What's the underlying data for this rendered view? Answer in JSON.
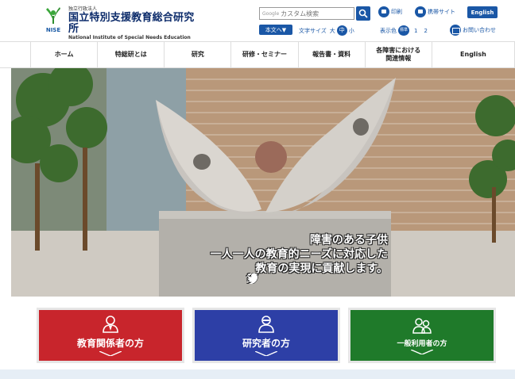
{
  "header": {
    "logo_small": "独立行政法人",
    "logo_jp": "国立特別支援教育総合研究所",
    "logo_en": "National Institute of Special Needs Education",
    "logo_mark": "NISE",
    "search_provider": "Google",
    "search_placeholder": "カスタム検索",
    "print_label": "印刷",
    "mobile_label": "携帯サイト",
    "english_label": "English",
    "skip_label": "本文へ▼",
    "font_size_label": "文字サイズ",
    "font_large": "大",
    "font_medium": "中",
    "font_small": "小",
    "color_label": "表示色",
    "color_standard": "標準",
    "color_1": "1",
    "color_2": "2",
    "contact_label": "お問い合わせ"
  },
  "nav": {
    "items": [
      {
        "label": "ホーム"
      },
      {
        "label": "特総研とは"
      },
      {
        "label": "研究"
      },
      {
        "label": "研修・セミナー"
      },
      {
        "label": "報告書・資料"
      },
      {
        "label": "各障害における\n関連情報"
      },
      {
        "label": "English"
      }
    ]
  },
  "hero": {
    "line1": "障害のある子供",
    "line2": "一人一人の教育的ニーズに対応した",
    "line3": "教育の実現に貢献します。",
    "facebook": "f"
  },
  "cards": [
    {
      "label": "教育関係者の方",
      "color": "#c8252c"
    },
    {
      "label": "研究者の方",
      "color": "#2d3fa6"
    },
    {
      "label": "一般利用者の方",
      "color": "#1f7a2a"
    }
  ],
  "colors": {
    "brand_blue": "#1a57a6",
    "nav_border": "#dddddd"
  }
}
